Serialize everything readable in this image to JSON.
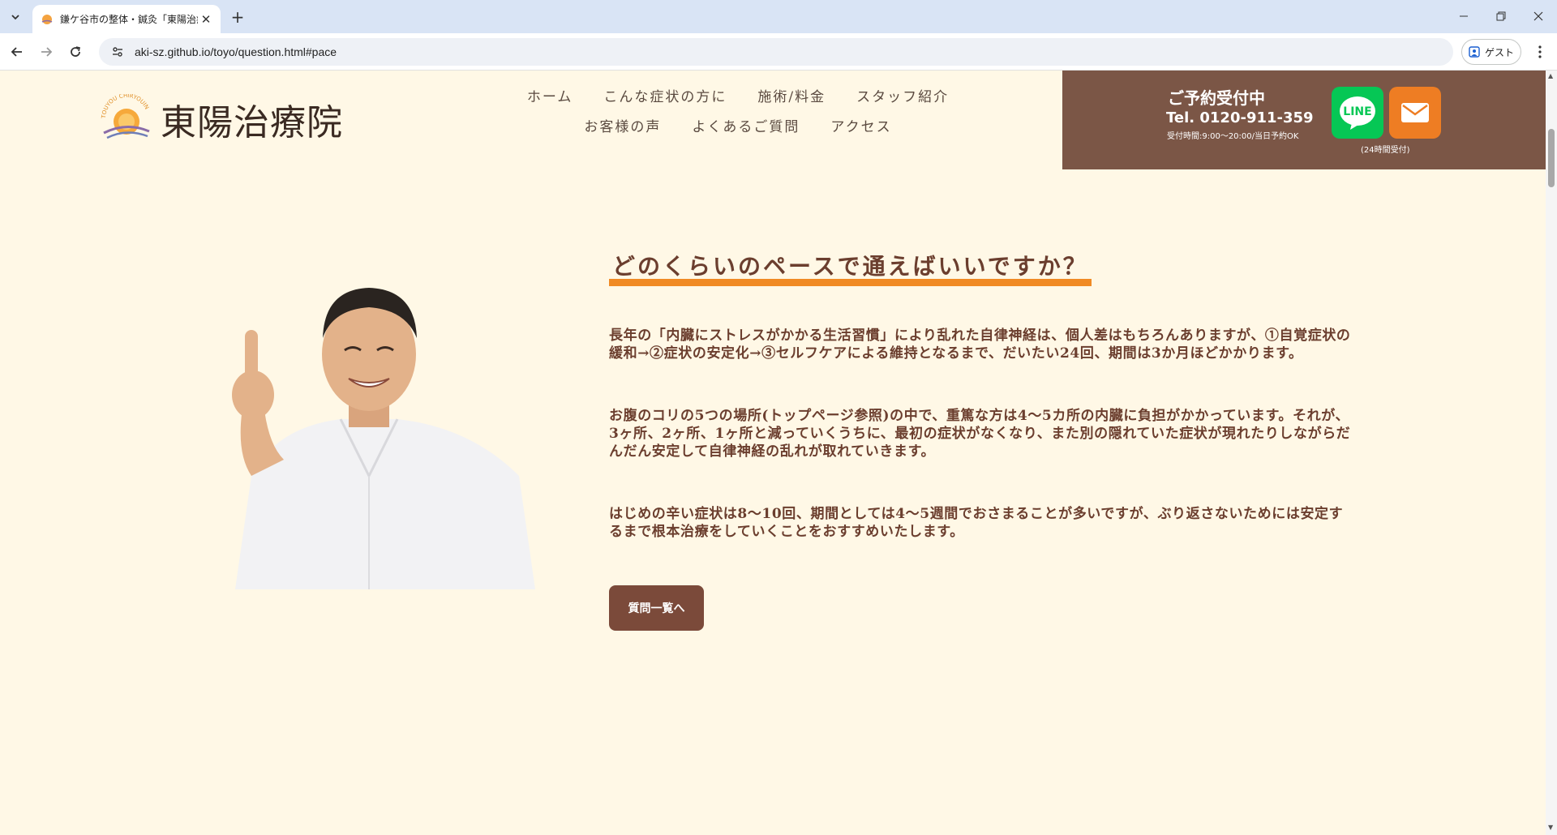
{
  "browser": {
    "tab_title": "鎌ケ谷市の整体・鍼灸「東陽治療院",
    "url": "aki-sz.github.io/toyo/question.html#pace",
    "guest_label": "ゲスト"
  },
  "site": {
    "logo_text": "東陽治療院",
    "logo_arc_text": "TOUYOU CHIRYOUIN",
    "nav": {
      "row1": [
        "ホーム",
        "こんな症状の方に",
        "施術/料金",
        "スタッフ紹介"
      ],
      "row2": [
        "お客様の声",
        "よくあるご質問",
        "アクセス"
      ]
    },
    "reserve": {
      "title": "ご予約受付中",
      "tel": "Tel. 0120-911-359",
      "hours": "受付時間:9:00〜20:00/当日予約OK",
      "line_label": "LINE",
      "note_24h": "(24時間受付)"
    }
  },
  "main": {
    "question_title": "どのくらいのペースで通えばいいですか？",
    "paragraphs": [
      "長年の「内臓にストレスがかかる生活習慣」により乱れた自律神経は、個人差はもちろんありますが、①自覚症状の緩和→②症状の安定化→③セルフケアによる維持となるまで、だいたい24回、期間は3か月ほどかかります。",
      "お腹のコリの5つの場所(トップページ参照)の中で、重篤な方は4〜5カ所の内臓に負担がかかっています。それが、3ヶ所、2ヶ所、1ヶ所と減っていくうちに、最初の症状がなくなり、また別の隠れていた症状が現れたりしながらだんだん安定して自律神経の乱れが取れていきます。",
      "はじめの辛い症状は8〜10回、期間としては4〜5週間でおさまることが多いですが、ぶり返さないためには安定するまで根本治療をしていくことをおすすめいたします。"
    ],
    "back_button": "質問一覧へ"
  },
  "colors": {
    "page_bg": "#fff8e6",
    "brown": "#7b5646",
    "text_brown": "#6b3e2e",
    "orange": "#f08a24",
    "line_green": "#06c755"
  }
}
